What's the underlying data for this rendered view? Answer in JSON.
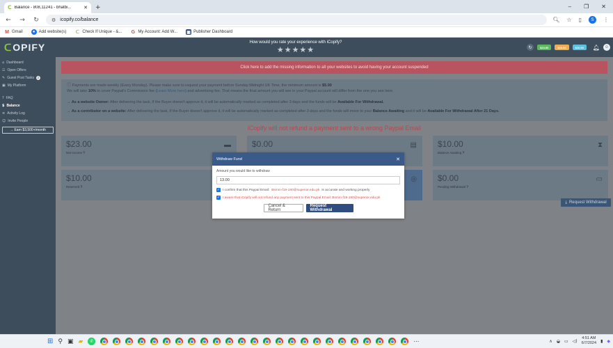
{
  "browser": {
    "tab_title": "Balance - 808,11241 - bhatbi...",
    "url": "icopify.co/balance",
    "bookmarks": [
      "Gmail",
      "Add website(s)",
      "Check If Unique - &...",
      "My Account: Add W...",
      "Publisher Dashboard"
    ],
    "profile_initial": "S"
  },
  "header": {
    "logo_text": "OPIFY",
    "rate_prompt": "How would you rate your experience with iCopify?",
    "stars": "★★★★★",
    "pills": [
      {
        "text": "$23.00",
        "color": "#5cb85c"
      },
      {
        "text": "$10.00",
        "color": "#f0ad4e"
      },
      {
        "text": "$10.00",
        "color": "#5bc0de"
      }
    ]
  },
  "sidebar": {
    "items": [
      {
        "icon": "⌂",
        "label": "Dashboard"
      },
      {
        "icon": "☷",
        "label": "Open Offers"
      },
      {
        "icon": "✎",
        "label": "Guest Post Tasks",
        "badge": "2"
      },
      {
        "icon": "▣",
        "label": "My Platform"
      },
      {
        "icon": "?",
        "label": "FAQ"
      },
      {
        "icon": "$",
        "label": "Balance"
      },
      {
        "icon": "≡",
        "label": "Activity Log"
      },
      {
        "icon": "☺",
        "label": "Invite People"
      }
    ],
    "earn_button": "→ Earn $3,500+/month"
  },
  "main": {
    "banner": "Click here to add the missing information to all your websites to avoid having your account suspended",
    "info": {
      "line1_pre": "Payments are made weekly (Every Monday). Please make sure to request your payment before Sunday Midnight UK Time, the minimum amount is ",
      "min_amount": "$5.00",
      "line2_pre": "We will take ",
      "fee_pct": "10%",
      "line2_mid": " to cover Paypal's Commission fee (",
      "learn_more": "Learn More here",
      "line2_post": ") and advertising fee. That means the final amount you will see in your Paypal account will differ from the one you see here.",
      "owner_title": "→ As a website Owner:",
      "owner_text": " After delivering the task, If the Buyer doesn't approve it, it will be automatically marked as completed after 3 days and the funds will be ",
      "owner_bold": "Available For Withdrawal.",
      "contrib_title": "→ As a contributor on a website:",
      "contrib_text": " After delivering the task, If the Buyer doesn't approve it, it will be automatically marked as completed after 3 days and the funds will move to your ",
      "contrib_bold1": "Balance Awaiting",
      "contrib_mid": " and it will be ",
      "contrib_bold2": "Available For Withdrawal After 21 Days."
    },
    "warning": "iCopify will not refund a payment sent to a wrong Paypal Email",
    "cards": [
      {
        "amount": "$23.00",
        "label": "Net Income"
      },
      {
        "amount": "$0.00",
        "label": ""
      },
      {
        "amount": "$10.00",
        "label": "Balance Awaiting"
      },
      {
        "amount": "$10.00",
        "label": "Reserved"
      },
      {
        "amount": "$0.00",
        "label": "Pending Withdrawal"
      }
    ],
    "withdraw_button": "Request Withdrawal"
  },
  "modal": {
    "title": "Withdraw Fund",
    "amount_label": "Amount you would like to withdraw",
    "amount_value": "13.00",
    "confirm_pre": "I confirm that this Paypal Email: ",
    "email": "Bsmm-f19-190@superior.edu.pk",
    "confirm_post": " is accurate and working properly",
    "aware_text": "I aware that iCopify will not refund any payment sent to this Paypal Email: Bsmm-f19-190@superior.edu.pk",
    "cancel_label": "Cancel & Return",
    "request_label": "Request Withdrawal"
  },
  "taskbar": {
    "time": "4:51 AM",
    "date": "6/7/2024"
  }
}
